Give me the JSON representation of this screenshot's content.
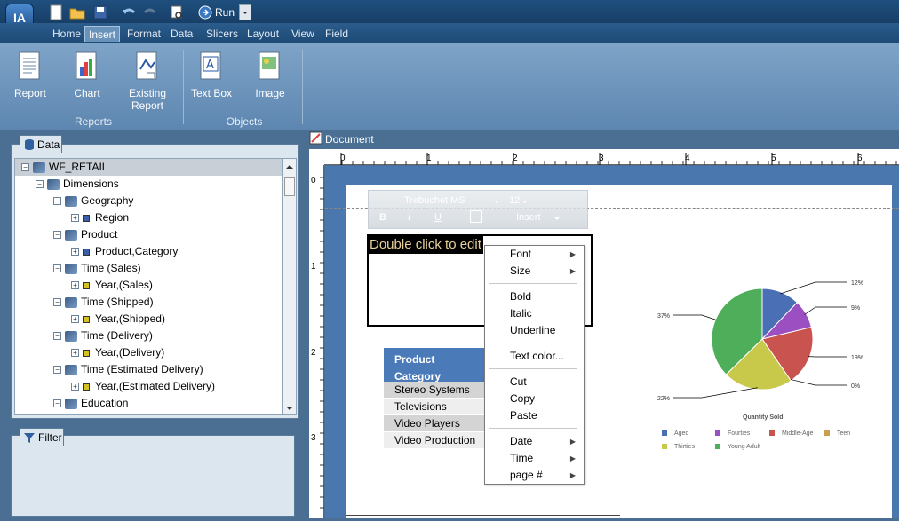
{
  "app": {
    "logo": "IA",
    "run_label": "Run"
  },
  "tabs": [
    "Home",
    "Insert",
    "Format",
    "Data",
    "Slicers",
    "Layout",
    "View",
    "Field"
  ],
  "ribbon": {
    "buttons": [
      {
        "label": "Report"
      },
      {
        "label": "Chart"
      },
      {
        "label": "Existing Report"
      },
      {
        "label": "Text Box"
      },
      {
        "label": "Image"
      }
    ],
    "groups": [
      "Reports",
      "Objects"
    ]
  },
  "data_panel": {
    "title": "Data",
    "tree": [
      {
        "label": "WF_RETAIL",
        "level": 0,
        "icon": "cube-icon",
        "expanded": true
      },
      {
        "label": "Dimensions",
        "level": 1,
        "icon": "cube-icon",
        "expanded": true
      },
      {
        "label": "Geography",
        "level": 2,
        "icon": "cube-icon",
        "expanded": true
      },
      {
        "label": "Region",
        "level": 3,
        "icon": "blue-square-icon",
        "expanded": false
      },
      {
        "label": "Product",
        "level": 2,
        "icon": "cube-icon",
        "expanded": true
      },
      {
        "label": "Product,Category",
        "level": 3,
        "icon": "blue-square-icon",
        "expanded": false
      },
      {
        "label": "Time (Sales)",
        "level": 2,
        "icon": "cube-icon",
        "expanded": true
      },
      {
        "label": "Year,(Sales)",
        "level": 3,
        "icon": "yellow-square-icon",
        "expanded": false
      },
      {
        "label": "Time (Shipped)",
        "level": 2,
        "icon": "cube-icon",
        "expanded": true
      },
      {
        "label": "Year,(Shipped)",
        "level": 3,
        "icon": "yellow-square-icon",
        "expanded": false
      },
      {
        "label": "Time (Delivery)",
        "level": 2,
        "icon": "cube-icon",
        "expanded": true
      },
      {
        "label": "Year,(Delivery)",
        "level": 3,
        "icon": "yellow-square-icon",
        "expanded": false
      },
      {
        "label": "Time (Estimated Delivery)",
        "level": 2,
        "icon": "cube-icon",
        "expanded": true
      },
      {
        "label": "Year,(Estimated Delivery)",
        "level": 3,
        "icon": "yellow-square-icon",
        "expanded": false
      },
      {
        "label": "Education",
        "level": 2,
        "icon": "cube-icon",
        "expanded": true
      }
    ]
  },
  "filter_panel": {
    "title": "Filter"
  },
  "document": {
    "title": "Document",
    "ruler_h": [
      "0",
      "1",
      "2",
      "3",
      "4",
      "5",
      "6"
    ],
    "ruler_v": [
      "0",
      "1",
      "2",
      "3"
    ],
    "format_toolbar": {
      "font": "Trebuchet MS",
      "size": "12",
      "insert": "Insert"
    },
    "textbox": {
      "text": "Double click to edit"
    },
    "table": {
      "header": "Product Category",
      "rows": [
        "Stereo Systems",
        "Televisions",
        "Video Players",
        "Video Production"
      ]
    }
  },
  "context_menu": {
    "items": [
      {
        "label": "Font",
        "submenu": true
      },
      {
        "label": "Size",
        "submenu": true
      },
      {
        "separator": true
      },
      {
        "label": "Bold",
        "submenu": false
      },
      {
        "label": "Italic",
        "submenu": false
      },
      {
        "label": "Underline",
        "submenu": false
      },
      {
        "separator": true
      },
      {
        "label": "Text color...",
        "submenu": false
      },
      {
        "separator": true
      },
      {
        "label": "Cut",
        "submenu": false
      },
      {
        "label": "Copy",
        "submenu": false
      },
      {
        "label": "Paste",
        "submenu": false
      },
      {
        "separator": true
      },
      {
        "label": "Date",
        "submenu": true
      },
      {
        "label": "Time",
        "submenu": true
      },
      {
        "label": "page #",
        "submenu": true
      }
    ]
  },
  "chart_data": {
    "type": "pie",
    "title": "Quantity Sold",
    "slices": [
      {
        "name": "Aged",
        "value": 12,
        "color": "#4a6fb5"
      },
      {
        "name": "Fourties",
        "value": 9,
        "color": "#9b4fc0"
      },
      {
        "name": "Middle-Age",
        "value": 19,
        "color": "#c9534f"
      },
      {
        "name": "Teen",
        "value": 0,
        "color": "#c9a04f"
      },
      {
        "name": "Thirties",
        "value": 22,
        "color": "#c8c84a"
      },
      {
        "name": "Young Adult",
        "value": 37,
        "color": "#4fae5a"
      }
    ],
    "labels": [
      "12%",
      "9%",
      "19%",
      "0%",
      "22%",
      "37%"
    ],
    "legend_position": "bottom"
  }
}
